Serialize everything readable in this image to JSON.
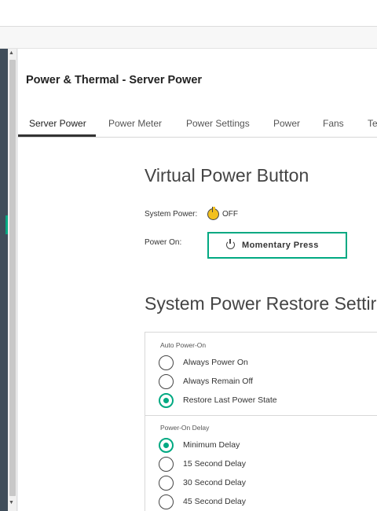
{
  "header": {
    "title": "Power & Thermal - Server Power"
  },
  "tabs": [
    {
      "label": "Server Power",
      "active": true
    },
    {
      "label": "Power Meter",
      "active": false
    },
    {
      "label": "Power Settings",
      "active": false
    },
    {
      "label": "Power",
      "active": false
    },
    {
      "label": "Fans",
      "active": false
    },
    {
      "label": "Te",
      "active": false
    }
  ],
  "virtual_power": {
    "heading": "Virtual Power Button",
    "system_power_label": "System Power:",
    "system_power_value": "OFF",
    "power_on_label": "Power On:",
    "momentary_press_label": "Momentary Press"
  },
  "restore_settings": {
    "heading": "System Power Restore Settir",
    "auto_power_on": {
      "label": "Auto Power-On",
      "options": [
        "Always Power On",
        "Always Remain Off",
        "Restore Last Power State"
      ],
      "selected": "Restore Last Power State"
    },
    "power_on_delay": {
      "label": "Power-On Delay",
      "options": [
        "Minimum Delay",
        "15 Second Delay",
        "30 Second Delay",
        "45 Second Delay"
      ],
      "selected": "Minimum Delay"
    }
  },
  "colors": {
    "accent": "#01a982",
    "power_icon": "#f2c01e",
    "sidenav": "#3f4d5a"
  },
  "icons": {
    "power_status": "power-status-icon",
    "momentary_press": "power-icon"
  }
}
